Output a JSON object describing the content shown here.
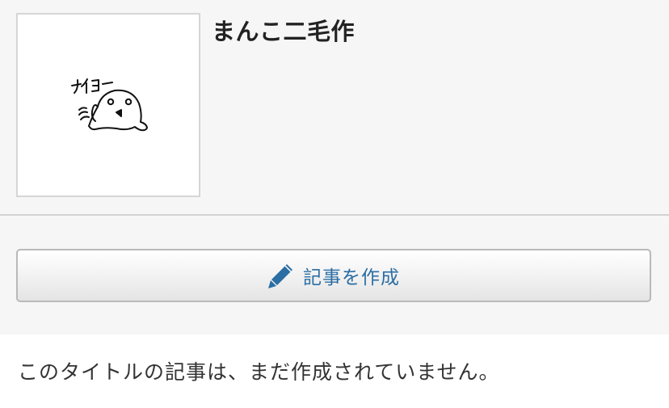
{
  "page": {
    "title": "まんこ二毛作",
    "thumbnail": {
      "icon": "ghost-doodle-icon",
      "caption_text": "ナイヨー"
    }
  },
  "actions": {
    "create_article_label": "記事を作成",
    "create_article_icon": "pencil-icon"
  },
  "message": {
    "no_article_text": "このタイトルの記事は、まだ作成されていません。"
  },
  "colors": {
    "accent": "#2b6ea4",
    "background": "#f6f6f6",
    "title_text": "#222222"
  }
}
